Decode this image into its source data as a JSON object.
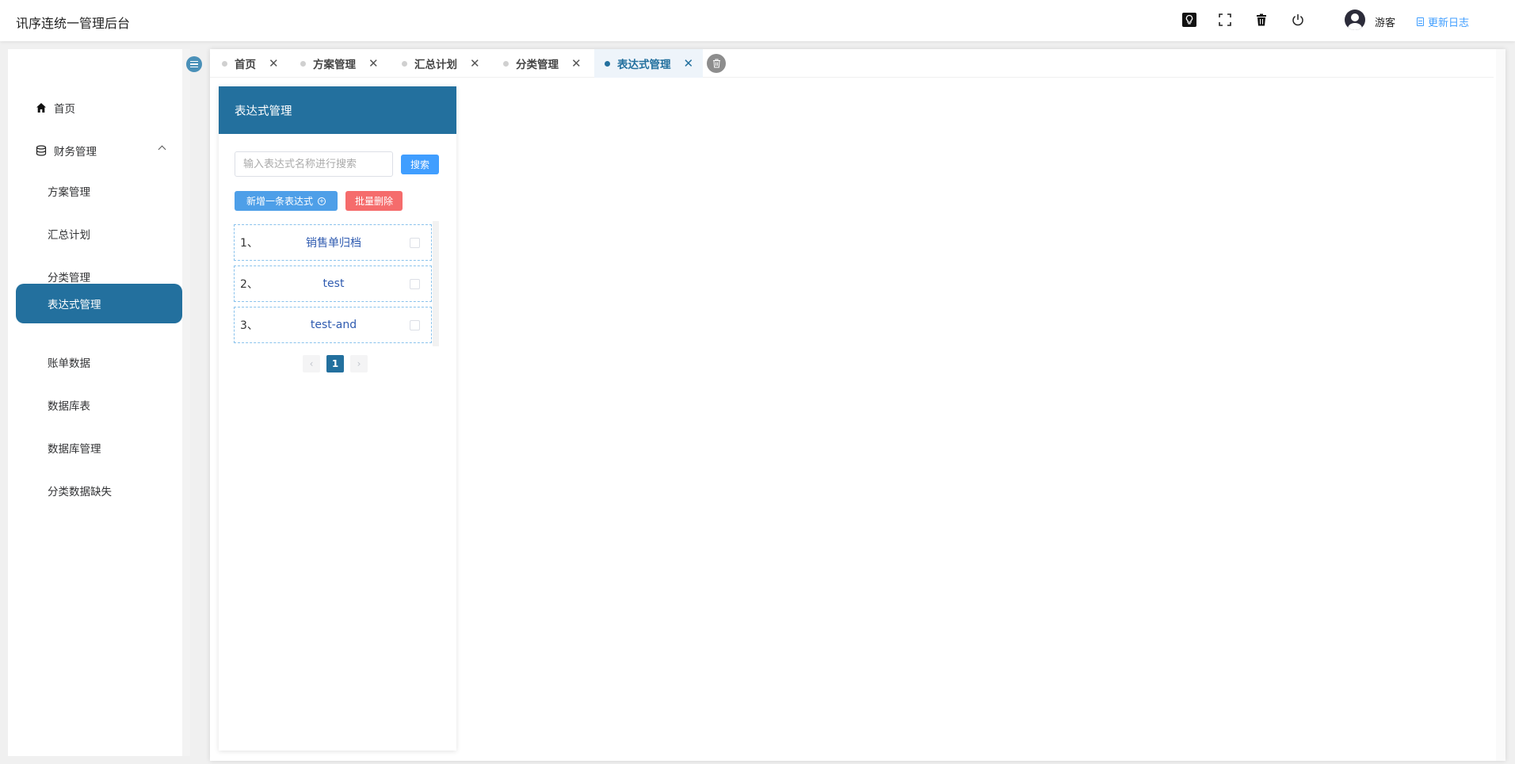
{
  "header": {
    "title": "讯序连统一管理后台",
    "icons": [
      "bulb-icon",
      "fullscreen-icon",
      "trash-icon",
      "power-icon"
    ],
    "user_name": "游客",
    "changelog": "更新日志"
  },
  "sidebar": {
    "items": [
      {
        "label": "首页",
        "icon": "home-icon"
      },
      {
        "label": "财务管理",
        "icon": "database-icon",
        "expanded": true
      },
      {
        "label": "方案管理"
      },
      {
        "label": "汇总计划"
      },
      {
        "label": "分类管理"
      },
      {
        "label": "表达式管理",
        "active": true
      },
      {
        "label": "账单数据"
      },
      {
        "label": "数据库表"
      },
      {
        "label": "数据库管理"
      },
      {
        "label": "分类数据缺失"
      }
    ]
  },
  "tabs": [
    {
      "label": "首页"
    },
    {
      "label": "方案管理"
    },
    {
      "label": "汇总计划"
    },
    {
      "label": "分类管理"
    },
    {
      "label": "表达式管理",
      "active": true
    }
  ],
  "tab_close_glyph": "✕",
  "panel": {
    "title": "表达式管理",
    "search_placeholder": "输入表达式名称进行搜索",
    "search_button": "搜索",
    "add_button": "新增一条表达式",
    "batch_delete_button": "批量删除",
    "items": [
      {
        "index": "1、",
        "name": "销售单归档"
      },
      {
        "index": "2、",
        "name": "test"
      },
      {
        "index": "3、",
        "name": "test-and"
      }
    ],
    "pagination": {
      "current": "1",
      "prev": "‹",
      "next": "›"
    }
  },
  "colors": {
    "primary": "#23709e",
    "button_blue": "#409eff",
    "danger": "#f56c6c"
  }
}
